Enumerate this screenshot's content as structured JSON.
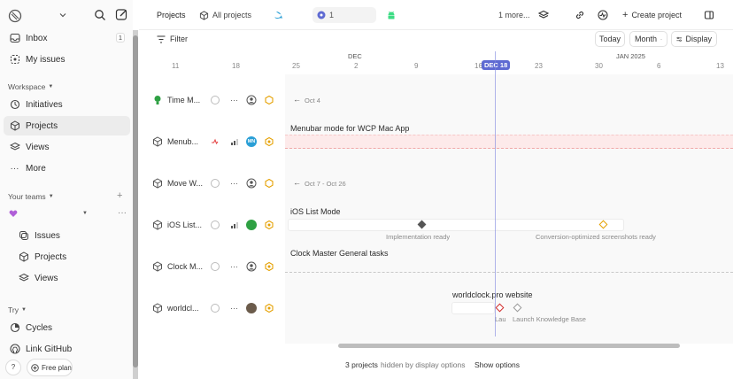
{
  "sidebar": {
    "items_top": [
      {
        "label": "Inbox",
        "badge": "1"
      },
      {
        "label": "My issues"
      }
    ],
    "workspace_label": "Workspace",
    "workspace_items": [
      {
        "label": "Initiatives"
      },
      {
        "label": "Projects"
      },
      {
        "label": "Views"
      },
      {
        "label": "More"
      }
    ],
    "teams_label": "Your teams",
    "team_items": [
      {
        "label": "Issues"
      },
      {
        "label": "Projects"
      },
      {
        "label": "Views"
      }
    ],
    "try_label": "Try",
    "try_items": [
      {
        "label": "Cycles"
      },
      {
        "label": "Link GitHub"
      }
    ],
    "help_label": "?",
    "free_plan_label": "Free plan"
  },
  "topbar": {
    "projects_tab": "Projects",
    "all_projects_tab": "All projects",
    "pill_text": "1",
    "more_label": "1 more...",
    "create_project": "Create project"
  },
  "toolbar": {
    "filter_label": "Filter",
    "today_label": "Today",
    "zoom_label": "Month",
    "display_label": "Display"
  },
  "timeline": {
    "months": [
      "DEC",
      "JAN 2025"
    ],
    "days": [
      "11",
      "18",
      "25",
      "2",
      "9",
      "16",
      "23",
      "30",
      "6",
      "13"
    ],
    "today": "DEC 18"
  },
  "projects": [
    {
      "name": "Time M...",
      "lead": "",
      "bar_title": "",
      "date_range": "Oct 4"
    },
    {
      "name": "Menub...",
      "lead": "MN",
      "bar_title": "Menubar mode for WCP Mac App",
      "date_range": ""
    },
    {
      "name": "Move W...",
      "lead": "",
      "bar_title": "",
      "date_range": "Oct 7 - Oct 26"
    },
    {
      "name": "iOS List...",
      "lead": "",
      "bar_title": "iOS List Mode",
      "date_range": ""
    },
    {
      "name": "Clock M...",
      "lead": "",
      "bar_title": "Clock Master General tasks",
      "date_range": ""
    },
    {
      "name": "worldcl...",
      "lead": "",
      "bar_title": "worldclock.pro website",
      "date_range": ""
    }
  ],
  "milestones": {
    "ios": [
      "Implementation ready",
      "Conversion-optimized screenshots ready"
    ],
    "web": [
      "Lau",
      "Launch Knowledge Base"
    ]
  },
  "footer": {
    "count": "3 projects",
    "hint": "hidden by display options",
    "show": "Show options"
  },
  "colors": {
    "accent": "#5e6ad2",
    "pink_band": "#fdeaea",
    "green_status": "#2ea043",
    "warning": "#e5a000"
  }
}
